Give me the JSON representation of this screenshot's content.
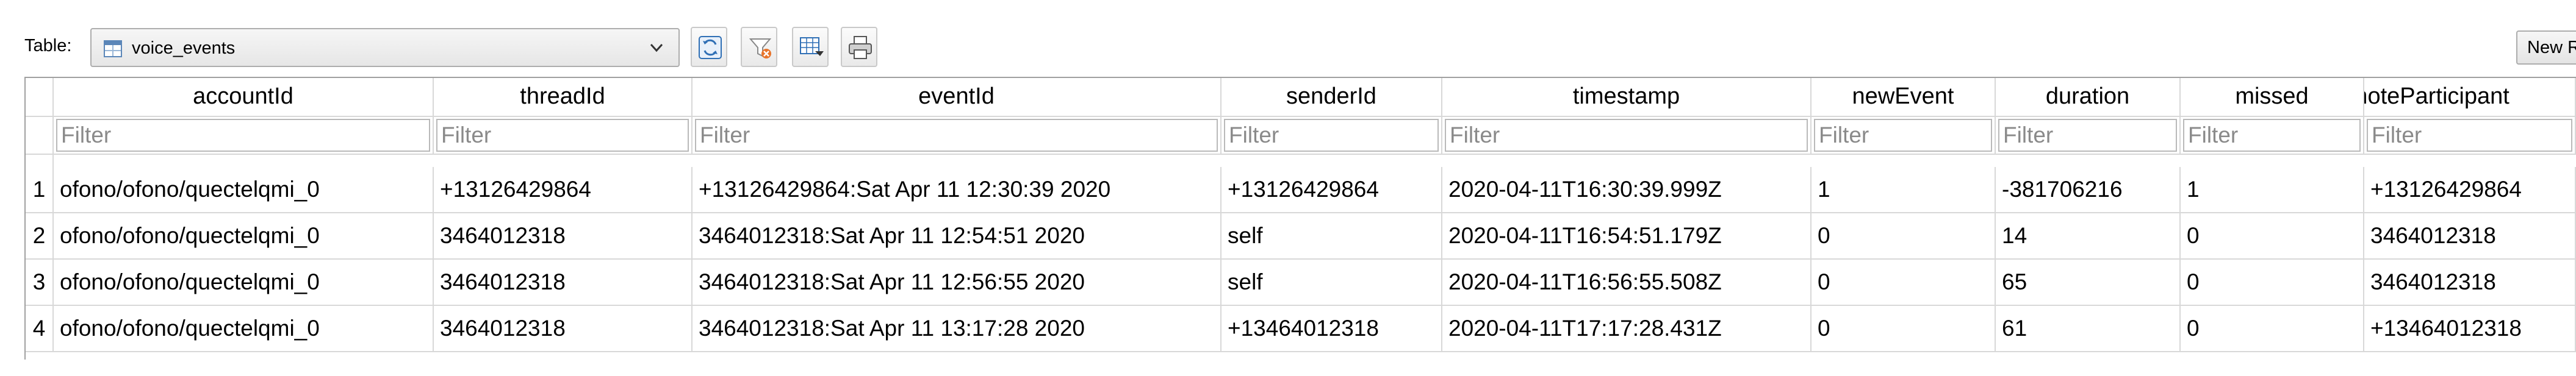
{
  "toolbar": {
    "table_label": "Table:",
    "table_select": {
      "value": "voice_events",
      "icon": "table-icon"
    },
    "buttons": [
      {
        "name": "refresh",
        "icon": "refresh-icon"
      },
      {
        "name": "clear-filters",
        "icon": "clear-filter-icon"
      },
      {
        "name": "save-filter",
        "icon": "save-filter-icon"
      },
      {
        "name": "print",
        "icon": "print-icon"
      }
    ],
    "new_record_label": "New Record"
  },
  "grid": {
    "columns": [
      "accountId",
      "threadId",
      "eventId",
      "senderId",
      "timestamp",
      "newEvent",
      "duration",
      "missed",
      "remoteParticipant"
    ],
    "filter_placeholder": "Filter",
    "rows": [
      {
        "num": "1",
        "cells": [
          "ofono/ofono/quectelqmi_0",
          "+13126429864",
          "+13126429864:Sat Apr 11 12:30:39 2020",
          "+13126429864",
          "2020-04-11T16:30:39.999Z",
          "1",
          "-381706216",
          "1",
          "+13126429864"
        ]
      },
      {
        "num": "2",
        "cells": [
          "ofono/ofono/quectelqmi_0",
          "3464012318",
          "3464012318:Sat Apr 11 12:54:51 2020",
          "self",
          "2020-04-11T16:54:51.179Z",
          "0",
          "14",
          "0",
          "3464012318"
        ]
      },
      {
        "num": "3",
        "cells": [
          "ofono/ofono/quectelqmi_0",
          "3464012318",
          "3464012318:Sat Apr 11 12:56:55 2020",
          "self",
          "2020-04-11T16:56:55.508Z",
          "0",
          "65",
          "0",
          "3464012318"
        ]
      },
      {
        "num": "4",
        "cells": [
          "ofono/ofono/quectelqmi_0",
          "3464012318",
          "3464012318:Sat Apr 11 13:17:28 2020",
          "+13464012318",
          "2020-04-11T17:17:28.431Z",
          "0",
          "61",
          "0",
          "+13464012318"
        ]
      }
    ]
  }
}
